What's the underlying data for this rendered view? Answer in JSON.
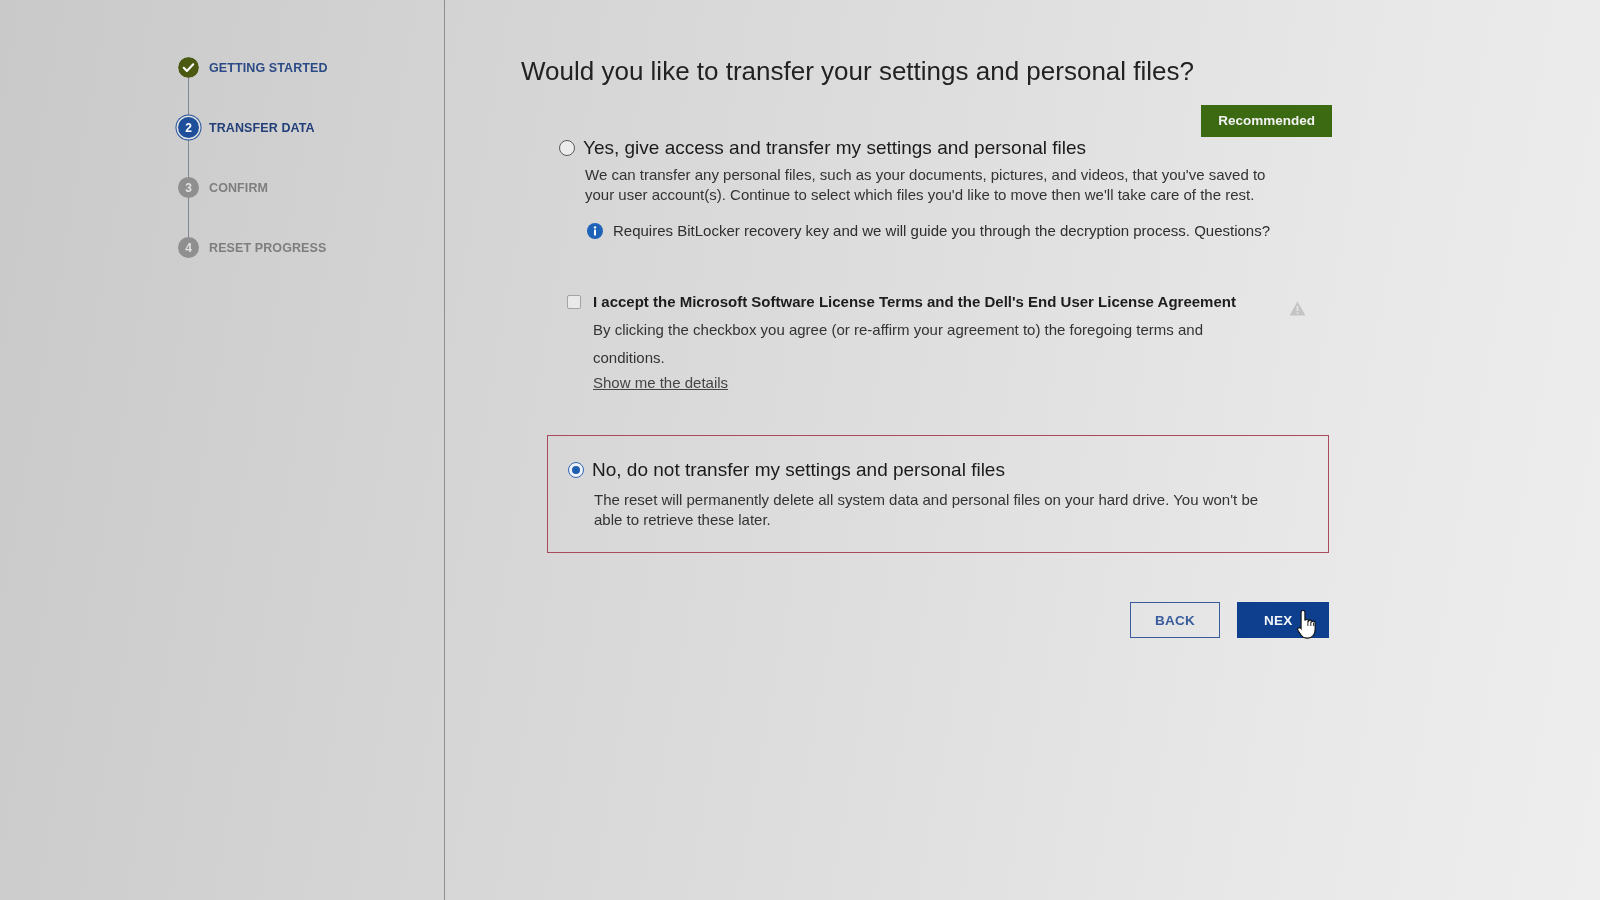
{
  "steps": [
    {
      "label": "GETTING STARTED",
      "completed": true,
      "selected": false
    },
    {
      "number": "2",
      "label": "TRANSFER DATA",
      "completed": false,
      "selected": true
    },
    {
      "number": "3",
      "label": "CONFIRM",
      "completed": false,
      "selected": false
    },
    {
      "number": "4",
      "label": "RESET PROGRESS",
      "completed": false,
      "selected": false
    }
  ],
  "heading": "Would you like to transfer your settings and personal files?",
  "options": [
    {
      "title": "Yes, give access and transfer my settings and personal files",
      "selected": false,
      "badge": "Recommended",
      "description": "We can transfer any personal files, such as your documents, pictures, and videos, that you've saved to your user account(s). Continue to select which files you'd like to move then we'll take care of the rest.",
      "note": "Requires BitLocker recovery key and we will guide you through the decryption process. Questions?",
      "agreement": {
        "checked": false,
        "label": "I accept the Microsoft Software License Terms and the Dell's End User License Agreement",
        "description": "By clicking the checkbox you agree (or re-affirm your agreement to) the foregoing terms and conditions.",
        "link": "Show me the details"
      }
    },
    {
      "title": "No, do not transfer my settings and personal files",
      "selected": true,
      "description": "The reset will permanently delete all system data and personal files on your hard drive. You won't be able to retrieve these later."
    }
  ],
  "buttons": [
    {
      "label": "BACK",
      "kind": "secondary"
    },
    {
      "label": "NEX",
      "kind": "primary"
    }
  ]
}
